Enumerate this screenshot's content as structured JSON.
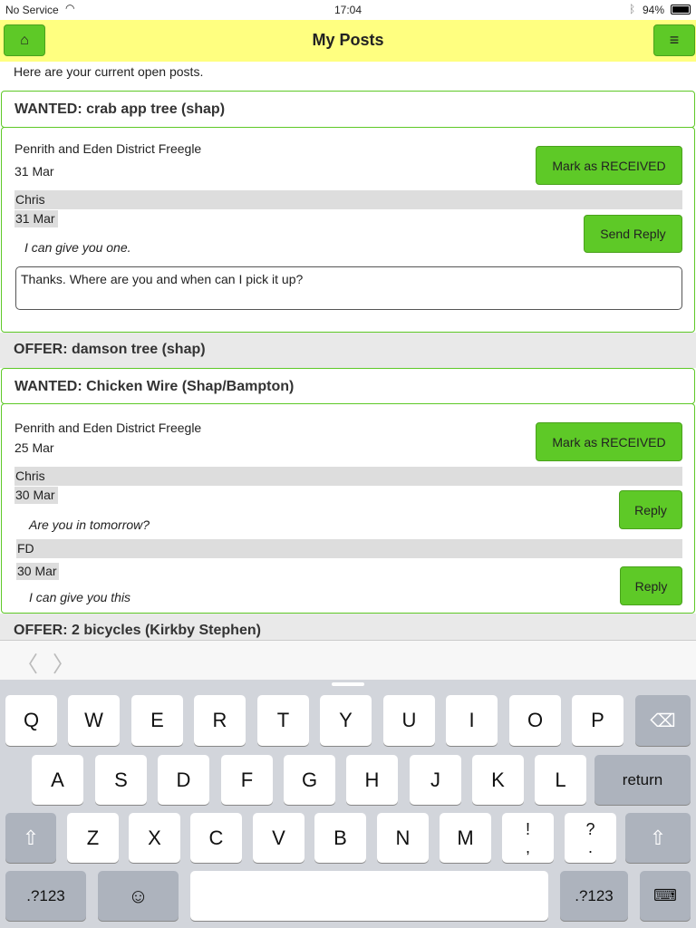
{
  "status": {
    "carrier": "No Service",
    "time": "17:04",
    "battery": "94%"
  },
  "header": {
    "title": "My Posts",
    "home_icon": "home-icon",
    "menu_icon": "menu-icon"
  },
  "intro": "Here are your current open posts.",
  "posts": [
    {
      "title": "WANTED: crab app tree (shap)",
      "group": "Penrith and Eden District Freegle",
      "date": "31 Mar",
      "mark_label": "Mark as RECEIVED",
      "replies": [
        {
          "name": "Chris",
          "date": "31 Mar",
          "message": "I can give you one.",
          "button": "Send Reply"
        }
      ],
      "reply_text": "Thanks. Where are you and when can I pick it up?"
    },
    {
      "title": "OFFER: damson tree (shap)"
    },
    {
      "title": "WANTED: Chicken Wire (Shap/Bampton)",
      "group": "Penrith and Eden District Freegle",
      "date": "25 Mar",
      "mark_label": "Mark as RECEIVED",
      "replies": [
        {
          "name": "Chris",
          "date": "30 Mar",
          "message": "Are you in tomorrow?",
          "button": "Reply"
        },
        {
          "name": "FD",
          "date": "30 Mar",
          "message": "I can give you this",
          "button": "Reply"
        }
      ]
    },
    {
      "title": "OFFER: 2 bicycles (Kirkby Stephen)"
    }
  ],
  "keyboard": {
    "row1": [
      "Q",
      "W",
      "E",
      "R",
      "T",
      "Y",
      "U",
      "I",
      "O",
      "P"
    ],
    "row2": [
      "A",
      "S",
      "D",
      "F",
      "G",
      "H",
      "J",
      "K",
      "L"
    ],
    "return": "return",
    "row3": [
      "Z",
      "X",
      "C",
      "V",
      "B",
      "N",
      "M",
      "!\n,",
      "?\n."
    ],
    "numbers": ".?123"
  },
  "colors": {
    "accent": "#5ec927",
    "header": "#ffff80"
  }
}
